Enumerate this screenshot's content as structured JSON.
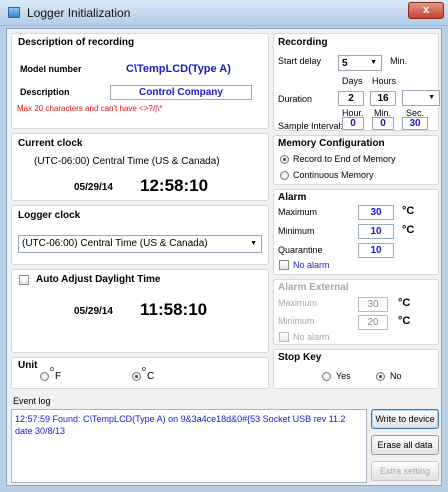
{
  "window": {
    "title": "Logger Initialization",
    "close_glyph": "x"
  },
  "description": {
    "heading": "Description of recording",
    "model_label": "Model number",
    "model_value": "C\\TempLCD(Type A)",
    "desc_label": "Description",
    "desc_value": "Control Company",
    "hint": "Max 20 characters and can't have <>?/|\\*"
  },
  "current_clock": {
    "heading": "Current clock",
    "timezone": "(UTC-06:00) Central Time (US & Canada)",
    "date": "05/29/14",
    "time": "12:58:10"
  },
  "logger_clock": {
    "heading": "Logger clock",
    "timezone": "(UTC-06:00) Central Time (US & Canada)",
    "auto_adjust_label": "Auto Adjust Daylight Time",
    "date": "05/29/14",
    "time": "11:58:10"
  },
  "unit": {
    "heading": "Unit",
    "f_label": "F",
    "c_label": "C",
    "deg": "o",
    "selected": "C"
  },
  "recording": {
    "heading": "Recording",
    "start_delay_label": "Start delay",
    "start_delay_value": "5",
    "start_delay_unit": "Min.",
    "days_label": "Days",
    "hours_label": "Hours",
    "duration_label": "Duration",
    "duration_days": "2",
    "duration_hours": "16",
    "hour_label": "Hour.",
    "min_label": "Min.",
    "sec_label": "Sec.",
    "sample_label": "Sample Interval:",
    "sample_hour": "0",
    "sample_min": "0",
    "sample_sec": "30"
  },
  "memory": {
    "heading": "Memory Configuration",
    "option1": "Record to End of Memory",
    "option2": "Continuous Memory",
    "selected": "option1"
  },
  "alarm": {
    "heading": "Alarm",
    "max_label": "Maximum",
    "max_value": "30",
    "min_label": "Minimum",
    "min_value": "10",
    "quarantine_label": "Quarantine",
    "quarantine_value": "10",
    "no_alarm_label": "No alarm",
    "unit": "°C"
  },
  "alarm_external": {
    "heading": "Alarm External",
    "max_label": "Maximum",
    "max_value": "30",
    "min_label": "Minimum",
    "min_value": "20",
    "no_alarm_label": "No alarm",
    "unit": "°C"
  },
  "stop_key": {
    "heading": "Stop Key",
    "yes_label": "Yes",
    "no_label": "No",
    "selected": "No"
  },
  "event_log": {
    "heading": "Event log",
    "text": "12:57:59 Found: C\\TempLCD(Type A) on 9&3a4ce18d&0#{53 Socket USB rev 11.2 date 30/8/13"
  },
  "buttons": {
    "write": "Write to device",
    "erase": "Erase all data",
    "extra": "Extra setting"
  },
  "colors": {
    "accent_blue": "#1a1acc",
    "hint_red": "#e01010",
    "disabled_gray": "#a8a8a8"
  }
}
